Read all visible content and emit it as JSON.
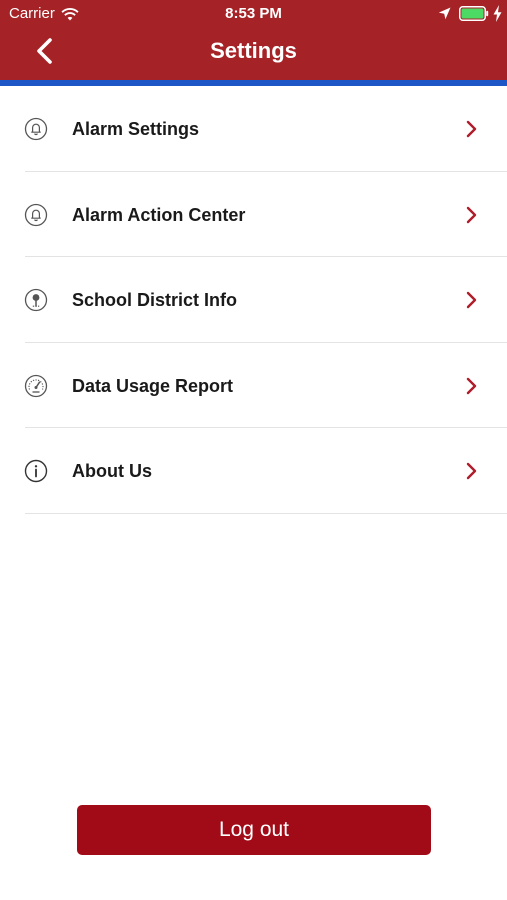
{
  "status_bar": {
    "carrier": "Carrier",
    "time": "8:53 PM",
    "icons": [
      "wifi-icon",
      "location-arrow-icon",
      "battery-full-icon",
      "charging-bolt-icon"
    ]
  },
  "nav": {
    "title": "Settings",
    "back_icon": "chevron-left-icon"
  },
  "menu": {
    "items": [
      {
        "label": "Alarm Settings",
        "icon": "bell-icon"
      },
      {
        "label": "Alarm Action Center",
        "icon": "bell-icon"
      },
      {
        "label": "School District Info",
        "icon": "location-pin-icon"
      },
      {
        "label": "Data Usage Report",
        "icon": "gauge-icon"
      },
      {
        "label": "About Us",
        "icon": "info-icon"
      }
    ],
    "chevron_icon": "chevron-right-icon"
  },
  "logout": {
    "label": "Log out"
  },
  "colors": {
    "header_bg": "#a52226",
    "accent_line": "#1d56c6",
    "chevron": "#b01c2a",
    "logout_bg": "#a00b17",
    "battery_green": "#4cd964"
  }
}
